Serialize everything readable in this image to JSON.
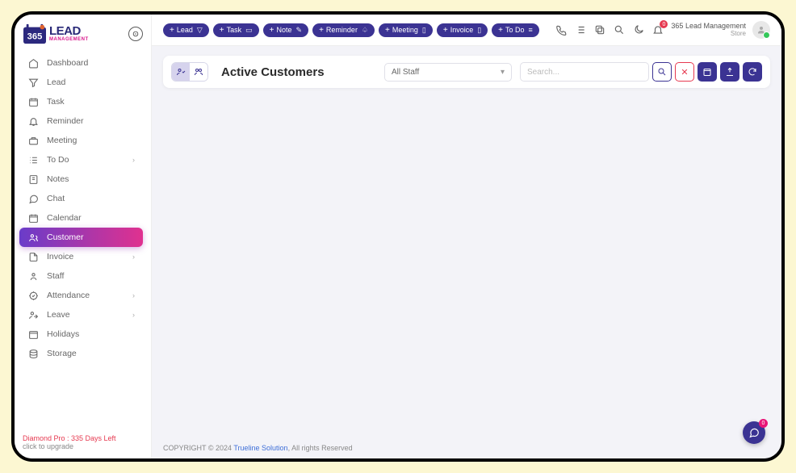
{
  "logo": {
    "main": "LEAD",
    "sub": "MANAGEMENT"
  },
  "sidebar": {
    "items": [
      {
        "label": "Dashboard",
        "icon": "home-icon",
        "expandable": false
      },
      {
        "label": "Lead",
        "icon": "funnel-icon",
        "expandable": false
      },
      {
        "label": "Task",
        "icon": "calendar-icon",
        "expandable": false
      },
      {
        "label": "Reminder",
        "icon": "bell-icon",
        "expandable": false
      },
      {
        "label": "Meeting",
        "icon": "briefcase-icon",
        "expandable": false
      },
      {
        "label": "To Do",
        "icon": "list-icon",
        "expandable": true
      },
      {
        "label": "Notes",
        "icon": "note-icon",
        "expandable": false
      },
      {
        "label": "Chat",
        "icon": "chat-icon",
        "expandable": false
      },
      {
        "label": "Calendar",
        "icon": "calendar-icon",
        "expandable": false
      },
      {
        "label": "Customer",
        "icon": "user-icon",
        "expandable": false,
        "active": true
      },
      {
        "label": "Invoice",
        "icon": "file-icon",
        "expandable": true
      },
      {
        "label": "Staff",
        "icon": "person-icon",
        "expandable": false
      },
      {
        "label": "Attendance",
        "icon": "target-icon",
        "expandable": true
      },
      {
        "label": "Leave",
        "icon": "exit-icon",
        "expandable": true
      },
      {
        "label": "Holidays",
        "icon": "calendar-icon",
        "expandable": false
      },
      {
        "label": "Storage",
        "icon": "database-icon",
        "expandable": false
      }
    ],
    "plan": "Diamond Pro : 335 Days Left",
    "upgrade": "click to upgrade"
  },
  "topbar": {
    "pills": [
      {
        "label": "Lead",
        "icon": "funnel-icon"
      },
      {
        "label": "Task",
        "icon": "calendar-icon"
      },
      {
        "label": "Note",
        "icon": "edit-icon"
      },
      {
        "label": "Reminder",
        "icon": "bell-icon"
      },
      {
        "label": "Meeting",
        "icon": "briefcase-icon"
      },
      {
        "label": "Invoice",
        "icon": "file-icon"
      },
      {
        "label": "To Do",
        "icon": "list-icon"
      }
    ],
    "notif_count": "0",
    "org_name": "365 Lead Management",
    "org_role": "Store"
  },
  "panel": {
    "title": "Active Customers",
    "staff_select": "All Staff",
    "search_placeholder": "Search..."
  },
  "footer": {
    "copyright": "COPYRIGHT © 2024 ",
    "company": "Trueline Solution",
    "tail": ", All rights Reserved"
  },
  "fab_badge": "0"
}
